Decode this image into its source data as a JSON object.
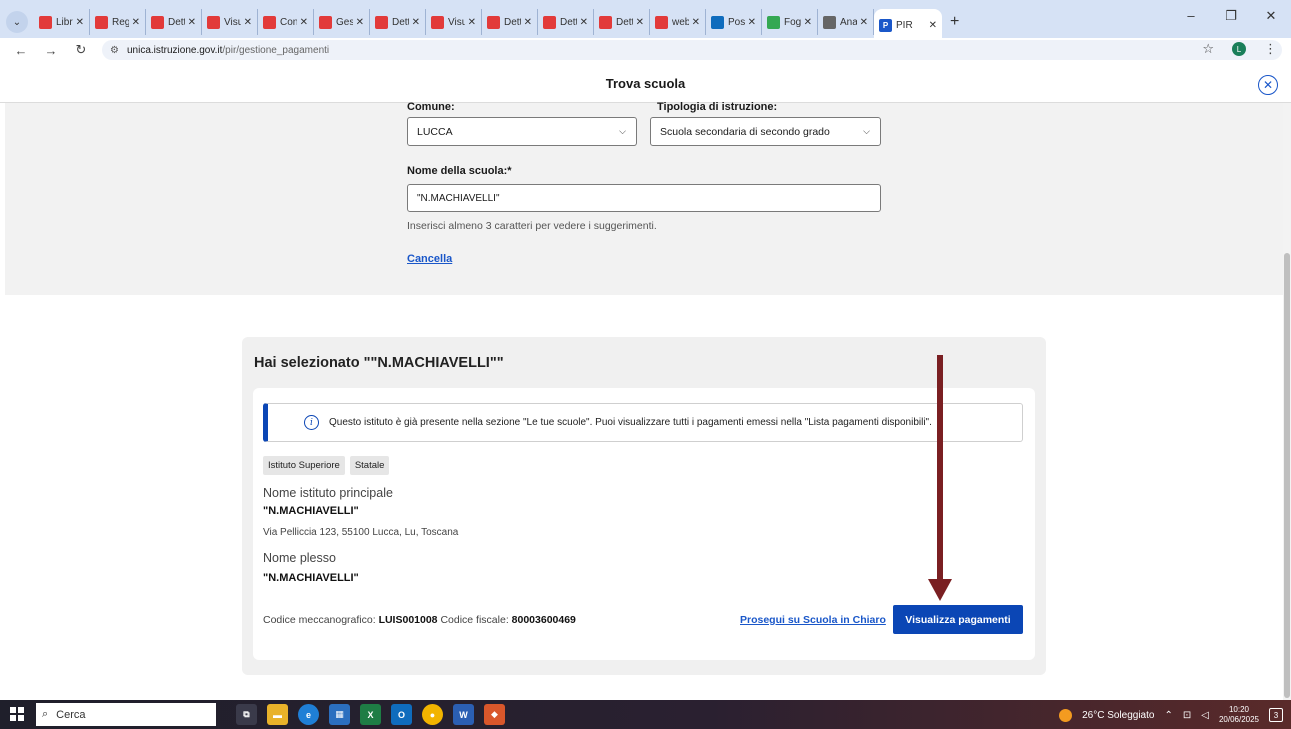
{
  "browser": {
    "tabs": [
      {
        "label": "Libri C",
        "color": "#e23a3a"
      },
      {
        "label": "Regist",
        "color": "#e23a3a"
      },
      {
        "label": "Detta",
        "color": "#e23a3a"
      },
      {
        "label": "Visual",
        "color": "#e23a3a"
      },
      {
        "label": "Consu",
        "color": "#e23a3a"
      },
      {
        "label": "Gestic",
        "color": "#e23a3a"
      },
      {
        "label": "Detta",
        "color": "#e23a3a"
      },
      {
        "label": "Visual",
        "color": "#e23a3a"
      },
      {
        "label": "Detta",
        "color": "#e23a3a"
      },
      {
        "label": "Detta",
        "color": "#e23a3a"
      },
      {
        "label": "Detta",
        "color": "#e23a3a"
      },
      {
        "label": "web.a",
        "color": "#e23a3a"
      },
      {
        "label": "Posta",
        "color": "#0f6cbd"
      },
      {
        "label": "Foglio",
        "color": "#34a853"
      },
      {
        "label": "Anagr",
        "color": "#666666"
      }
    ],
    "active_tab": {
      "label": "PIR"
    },
    "url_host": "unica.istruzione.gov.it",
    "url_path": "/pir/gestione_pagamenti",
    "profile_initial": "L"
  },
  "modal": {
    "title": "Trova scuola"
  },
  "filters": {
    "comune_label": "Comune:",
    "comune_value": "LUCCA",
    "tipologia_label": "Tipologia di istruzione:",
    "tipologia_value": "Scuola secondaria di secondo grado",
    "nome_label": "Nome della scuola:*",
    "nome_value": "\"N.MACHIAVELLI\"",
    "hint": "Inserisci almeno 3 caratteri per vedere i suggerimenti.",
    "cancel": "Cancella"
  },
  "result": {
    "title": "Hai selezionato \"\"N.MACHIAVELLI\"\"",
    "alert": "Questo istituto è già presente nella sezione \"Le tue scuole\". Puoi visualizzare tutti i pagamenti emessi nella \"Lista pagamenti disponibili\".",
    "tags": [
      "Istituto Superiore",
      "Statale"
    ],
    "istituto_label": "Nome istituto principale",
    "istituto_value": "\"N.MACHIAVELLI\"",
    "address": "Via Pelliccia 123, 55100 Lucca, Lu, Toscana",
    "plesso_label": "Nome plesso",
    "plesso_value": "\"N.MACHIAVELLI\"",
    "codice_mecc_label": "Codice meccanografico:",
    "codice_mecc_value": "LUIS001008",
    "codice_fiscale_label": "Codice fiscale:",
    "codice_fiscale_value": "80003600469",
    "link_scuola_in_chiaro": "Prosegui su Scuola in Chiaro",
    "button_pagamenti": "Visualizza pagamenti"
  },
  "taskbar": {
    "search_placeholder": "Cerca",
    "weather": "26°C Soleggiato",
    "time": "10:20",
    "date": "20/06/2025"
  },
  "colors": {
    "primary": "#0b46b5",
    "link": "#1a57c9",
    "arrow": "#7a1f22"
  }
}
